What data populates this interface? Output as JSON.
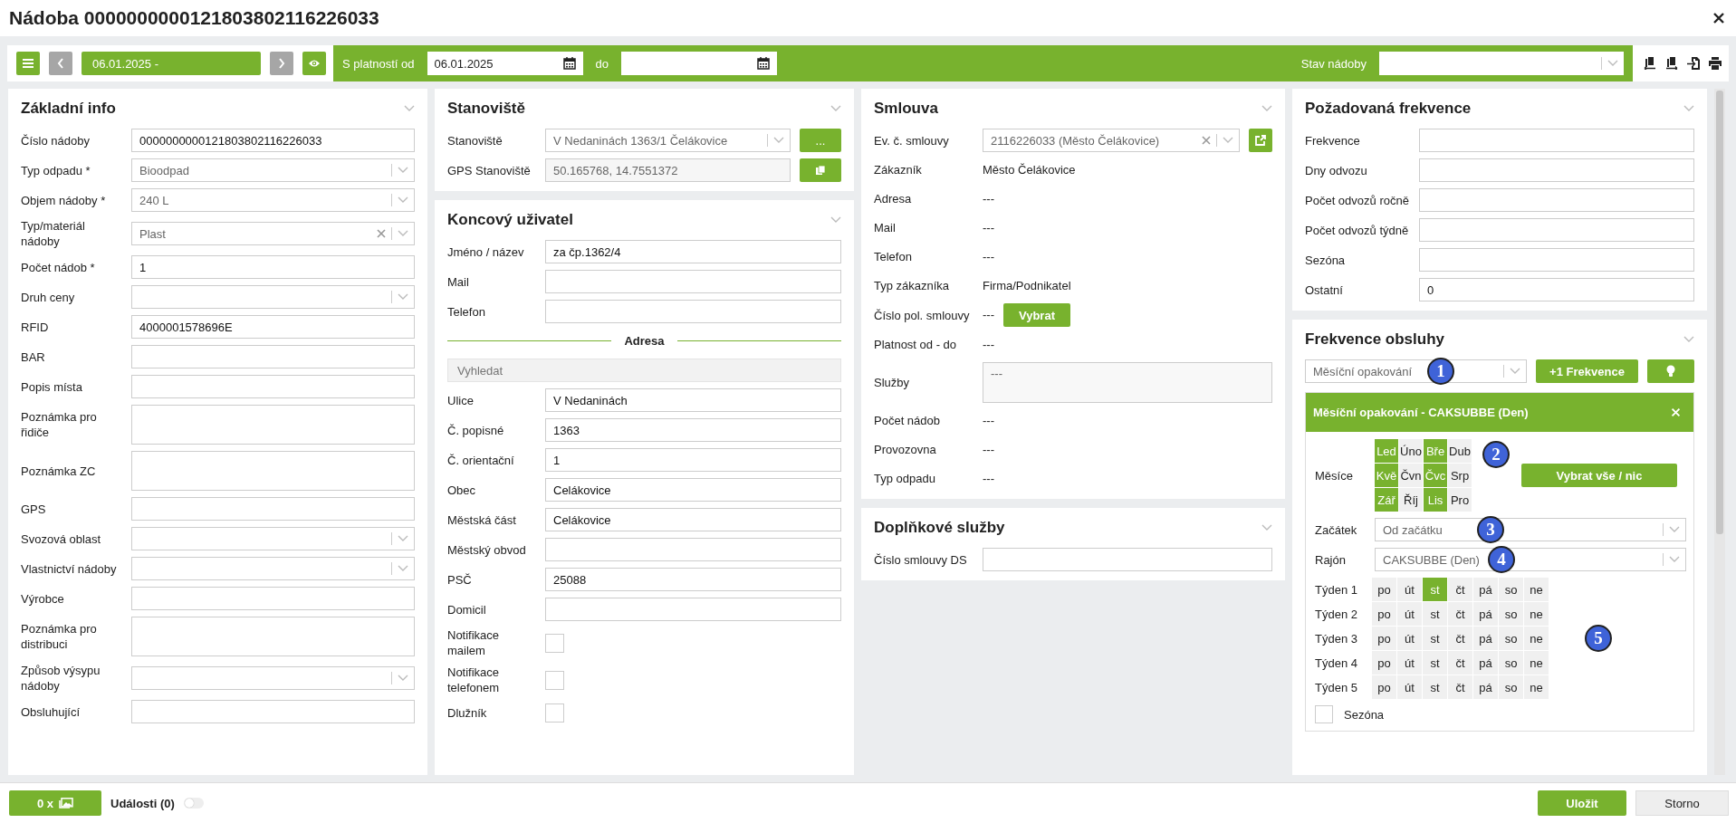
{
  "window": {
    "title": "Nádoba 0000000000121803802116226033"
  },
  "toolbar": {
    "period": "06.01.2025 -",
    "valid_from_label": "S platností od",
    "valid_from": "06.01.2025",
    "valid_to_label": "do",
    "state_label": "Stav nádoby"
  },
  "columns": [
    {
      "panels": [
        {
          "title": "Základní info",
          "fields": [
            {
              "kind": "text",
              "label": "Číslo nádoby",
              "value": "0000000000121803802116226033"
            },
            {
              "kind": "select",
              "label": "Typ odpadu *",
              "value": "Bioodpad"
            },
            {
              "kind": "select",
              "label": "Objem nádoby *",
              "value": "240 L"
            },
            {
              "kind": "select",
              "label": "Typ/materiál nádoby",
              "value": "Plast",
              "clearable": true
            },
            {
              "kind": "text",
              "label": "Počet nádob *",
              "value": "1"
            },
            {
              "kind": "select",
              "label": "Druh ceny"
            },
            {
              "kind": "text",
              "label": "RFID",
              "value": "4000001578696E"
            },
            {
              "kind": "text",
              "label": "BAR"
            },
            {
              "kind": "text",
              "label": "Popis místa"
            },
            {
              "kind": "textarea",
              "label": "Poznámka pro řidiče"
            },
            {
              "kind": "textarea",
              "label": "Poznámka ZC"
            },
            {
              "kind": "text",
              "label": "GPS"
            },
            {
              "kind": "select",
              "label": "Svozová oblast"
            },
            {
              "kind": "select",
              "label": "Vlastnictví nádoby"
            },
            {
              "kind": "text",
              "label": "Výrobce"
            },
            {
              "kind": "textarea",
              "label": "Poznámka pro distribuci"
            },
            {
              "kind": "select",
              "label": "Způsob výsypu nádoby"
            },
            {
              "kind": "text",
              "label": "Obsluhující"
            }
          ]
        }
      ]
    },
    {
      "panels": [
        {
          "title": "Stanoviště",
          "fields": [
            {
              "kind": "select_button",
              "label": "Stanoviště",
              "value": "V Nedaninách 1363/1 Čelákovice",
              "button": "..."
            },
            {
              "kind": "readonly_copy",
              "label": "GPS Stanoviště",
              "value": "50.165768, 14.7551372"
            }
          ]
        },
        {
          "title": "Koncový uživatel",
          "fields": [
            {
              "kind": "text",
              "label": "Jméno / název",
              "value": "za čp.1362/4"
            },
            {
              "kind": "text",
              "label": "Mail"
            },
            {
              "kind": "text",
              "label": "Telefon"
            },
            {
              "kind": "divider",
              "label": "Adresa"
            },
            {
              "kind": "search",
              "placeholder": "Vyhledat"
            },
            {
              "kind": "text",
              "label": "Ulice",
              "value": "V Nedaninách"
            },
            {
              "kind": "text",
              "label": "Č. popisné",
              "value": "1363"
            },
            {
              "kind": "text",
              "label": "Č. orientační",
              "value": "1"
            },
            {
              "kind": "text",
              "label": "Obec",
              "value": "Celákovice"
            },
            {
              "kind": "text",
              "label": "Městská část",
              "value": "Celákovice"
            },
            {
              "kind": "text",
              "label": "Městský obvod"
            },
            {
              "kind": "text",
              "label": "PSČ",
              "value": "25088"
            },
            {
              "kind": "text",
              "label": "Domicil"
            },
            {
              "kind": "checkbox",
              "label": "Notifikace mailem",
              "checked": false
            },
            {
              "kind": "checkbox",
              "label": "Notifikace telefonem",
              "checked": false
            },
            {
              "kind": "checkbox",
              "label": "Dlužník",
              "checked": false
            }
          ]
        }
      ]
    },
    {
      "panels": [
        {
          "title": "Smlouva",
          "fields": [
            {
              "kind": "select_link",
              "label": "Ev. č. smlouvy",
              "value": "2116226033 (Město Čelákovice)",
              "clearable": true
            },
            {
              "kind": "value",
              "label": "Zákazník",
              "value": "Město Čelákovice"
            },
            {
              "kind": "value",
              "label": "Adresa",
              "value": "---"
            },
            {
              "kind": "value",
              "label": "Mail",
              "value": "---"
            },
            {
              "kind": "value",
              "label": "Telefon",
              "value": "---"
            },
            {
              "kind": "value",
              "label": "Typ zákazníka",
              "value": "Firma/Podnikatel"
            },
            {
              "kind": "value_button",
              "label": "Číslo pol. smlouvy",
              "value": "---",
              "button": "Vybrat"
            },
            {
              "kind": "value",
              "label": "Platnost od - do",
              "value": "---"
            },
            {
              "kind": "readonly_area",
              "label": "Služby",
              "value": "---"
            },
            {
              "kind": "value",
              "label": "Počet nádob",
              "value": "---"
            },
            {
              "kind": "value",
              "label": "Provozovna",
              "value": "---"
            },
            {
              "kind": "value",
              "label": "Typ odpadu",
              "value": "---"
            }
          ]
        },
        {
          "title": "Doplňkové služby",
          "fields": [
            {
              "kind": "text",
              "label": "Číslo smlouvy DS"
            }
          ]
        }
      ]
    },
    {
      "panels": [
        {
          "title": "Požadovaná frekvence",
          "fields": [
            {
              "kind": "text",
              "label": "Frekvence"
            },
            {
              "kind": "text",
              "label": "Dny odvozu"
            },
            {
              "kind": "text",
              "label": "Počet odvozů ročně"
            },
            {
              "kind": "text",
              "label": "Počet odvozů týdně"
            },
            {
              "kind": "text",
              "label": "Sezóna"
            },
            {
              "kind": "text",
              "label": "Ostatní",
              "value": "0"
            }
          ]
        },
        {
          "title": "Frekvence obsluhy",
          "kind": "frequency",
          "type_select": "Měsíční opakování",
          "type_marker": "1",
          "add_button": "+1 Frekvence",
          "item": {
            "title": "Měsíční opakování - CAKSUBBE (Den)",
            "months_label": "Měsíce",
            "months_marker": "2",
            "select_all_button": "Vybrat vše / nic",
            "months": [
              {
                "label": "Led",
                "selected": true
              },
              {
                "label": "Úno",
                "selected": false
              },
              {
                "label": "Bře",
                "selected": true
              },
              {
                "label": "Dub",
                "selected": false
              },
              {
                "label": "Kvě",
                "selected": true
              },
              {
                "label": "Čvn",
                "selected": false
              },
              {
                "label": "Čvc",
                "selected": true
              },
              {
                "label": "Srp",
                "selected": false
              },
              {
                "label": "Zář",
                "selected": true
              },
              {
                "label": "Říj",
                "selected": false
              },
              {
                "label": "Lis",
                "selected": true
              },
              {
                "label": "Pro",
                "selected": false
              }
            ],
            "start_label": "Začátek",
            "start": "Od začátku",
            "start_marker": "3",
            "district_label": "Rajón",
            "district": "CAKSUBBE (Den)",
            "district_marker": "4",
            "weeks_marker": "5",
            "weeks": [
              {
                "label": "Týden 1",
                "days": [
                  {
                    "label": "po",
                    "selected": false
                  },
                  {
                    "label": "út",
                    "selected": false
                  },
                  {
                    "label": "st",
                    "selected": true
                  },
                  {
                    "label": "čt",
                    "selected": false
                  },
                  {
                    "label": "pá",
                    "selected": false
                  },
                  {
                    "label": "so",
                    "selected": false
                  },
                  {
                    "label": "ne",
                    "selected": false
                  }
                ]
              },
              {
                "label": "Týden 2",
                "days": [
                  {
                    "label": "po",
                    "selected": false
                  },
                  {
                    "label": "út",
                    "selected": false
                  },
                  {
                    "label": "st",
                    "selected": false
                  },
                  {
                    "label": "čt",
                    "selected": false
                  },
                  {
                    "label": "pá",
                    "selected": false
                  },
                  {
                    "label": "so",
                    "selected": false
                  },
                  {
                    "label": "ne",
                    "selected": false
                  }
                ]
              },
              {
                "label": "Týden 3",
                "days": [
                  {
                    "label": "po",
                    "selected": false
                  },
                  {
                    "label": "út",
                    "selected": false
                  },
                  {
                    "label": "st",
                    "selected": false
                  },
                  {
                    "label": "čt",
                    "selected": false
                  },
                  {
                    "label": "pá",
                    "selected": false
                  },
                  {
                    "label": "so",
                    "selected": false
                  },
                  {
                    "label": "ne",
                    "selected": false
                  }
                ]
              },
              {
                "label": "Týden 4",
                "days": [
                  {
                    "label": "po",
                    "selected": false
                  },
                  {
                    "label": "út",
                    "selected": false
                  },
                  {
                    "label": "st",
                    "selected": false
                  },
                  {
                    "label": "čt",
                    "selected": false
                  },
                  {
                    "label": "pá",
                    "selected": false
                  },
                  {
                    "label": "so",
                    "selected": false
                  },
                  {
                    "label": "ne",
                    "selected": false
                  }
                ]
              },
              {
                "label": "Týden 5",
                "days": [
                  {
                    "label": "po",
                    "selected": false
                  },
                  {
                    "label": "út",
                    "selected": false
                  },
                  {
                    "label": "st",
                    "selected": false
                  },
                  {
                    "label": "čt",
                    "selected": false
                  },
                  {
                    "label": "pá",
                    "selected": false
                  },
                  {
                    "label": "so",
                    "selected": false
                  },
                  {
                    "label": "ne",
                    "selected": false
                  }
                ]
              }
            ],
            "season": {
              "label": "Sezóna",
              "checked": false
            }
          }
        }
      ]
    }
  ],
  "footer": {
    "photos_button": "0 x",
    "events_label": "Události (0)",
    "events_on": false,
    "save_button": "Uložit",
    "cancel_button": "Storno"
  }
}
